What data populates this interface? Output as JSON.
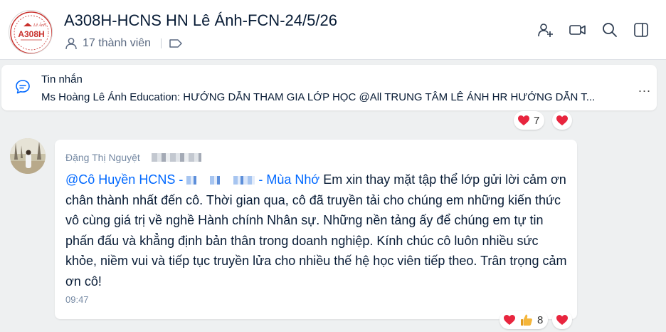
{
  "header": {
    "logo_text": "A308H",
    "logo_small": "Lê Ánh",
    "title": "A308H-HCNS HN Lê Ánh-FCN-24/5/26",
    "members": "17 thành viên"
  },
  "pinned": {
    "label": "Tin nhắn",
    "text": "Ms Hoàng Lê Ánh Education: HƯỚNG DẪN THAM GIA LỚP HỌC @All TRUNG TÂM LÊ ÁNH HR HƯỚNG DẪN T...",
    "more": "..."
  },
  "prev_reactions": {
    "count": "7"
  },
  "message": {
    "sender": "Đặng Thị Nguyệt",
    "mention_start": "@Cô Huyền HCNS -",
    "mention_end": "- Mùa Nhớ",
    "body": " Em xin thay mặt tập thể lớp gửi lời cảm ơn chân thành nhất đến cô. Thời gian qua, cô đã truyền tải cho chúng em những kiến thức vô cùng giá trị về nghề Hành chính Nhân sự. Những nền tảng ấy để chúng em tự tin phấn đấu và khẳng định bản thân trong doanh nghiệp. Kính chúc cô luôn nhiều sức khỏe, niềm vui và tiếp tục truyền lửa cho nhiều thế hệ học viên tiếp theo. Trân trọng cảm ơn cô!",
    "time": "09:47",
    "reaction_count": "8"
  },
  "colors": {
    "accent": "#0068ff",
    "heart": "#e8253e",
    "background": "#eef0f1"
  }
}
